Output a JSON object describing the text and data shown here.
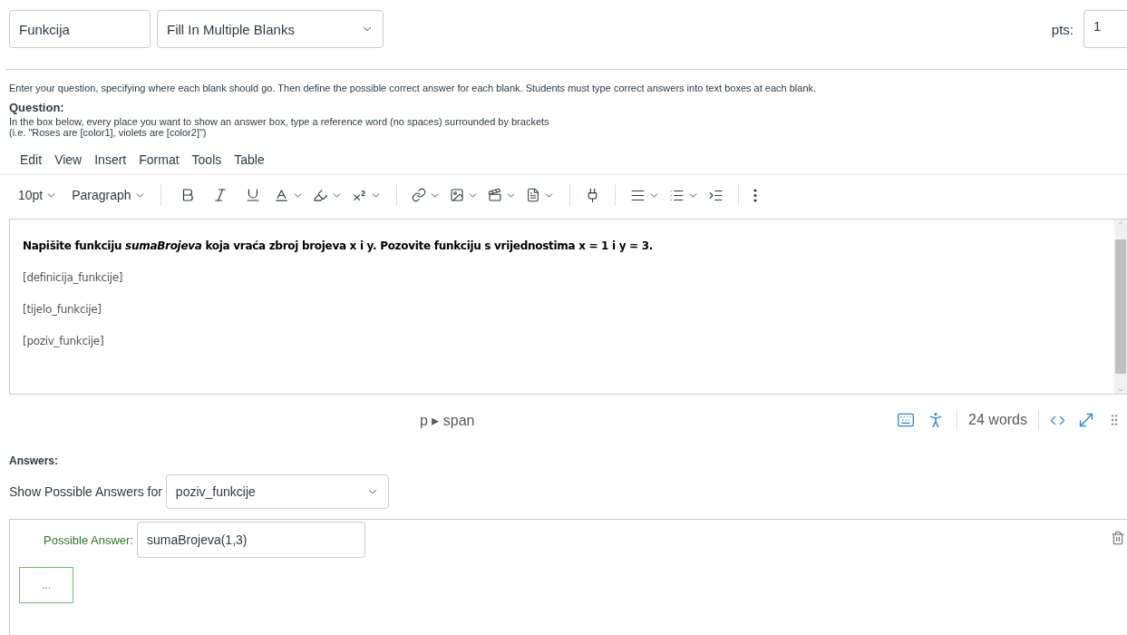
{
  "question_name": {
    "value": "Funkcija"
  },
  "question_type": {
    "value": "Fill In Multiple Blanks"
  },
  "points": {
    "label": "pts:",
    "value": "1"
  },
  "instructions": "Enter your question, specifying where each blank should go. Then define the possible correct answer for each blank. Students must type correct answers into text boxes at each blank.",
  "question_heading": "Question:",
  "hint_lines": [
    "In the box below, every place you want to show an answer box, type a reference word (no spaces) surrounded by brackets",
    "(i.e. \"Roses are [color1], violets are [color2]\")"
  ],
  "editor": {
    "menu": [
      "Edit",
      "View",
      "Insert",
      "Format",
      "Tools",
      "Table"
    ],
    "font_size": "10pt",
    "block_format": "Paragraph",
    "content": [
      {
        "kind": "prompt",
        "text": "Napišite funkciju *sumaBrojeva* koja vraća zbroj brojeva x i y. Pozovite funkciju s vrijednostima x = 1 i y = 3."
      },
      {
        "kind": "blank",
        "text": "[definicija_funkcije]"
      },
      {
        "kind": "blank",
        "text": "[tijelo_funkcije]"
      },
      {
        "kind": "blank",
        "text": "[poziv_funkcije]"
      }
    ],
    "path": "p ▸ span",
    "word_count": "24 words"
  },
  "answers": {
    "heading": "Answers:",
    "blank_label": "Show Possible Answers for",
    "blank_value": "poziv_funkcije",
    "possible": [
      {
        "label": "Possible Answer:",
        "value": "sumaBrojeva(1,3)"
      }
    ],
    "more": "..."
  }
}
